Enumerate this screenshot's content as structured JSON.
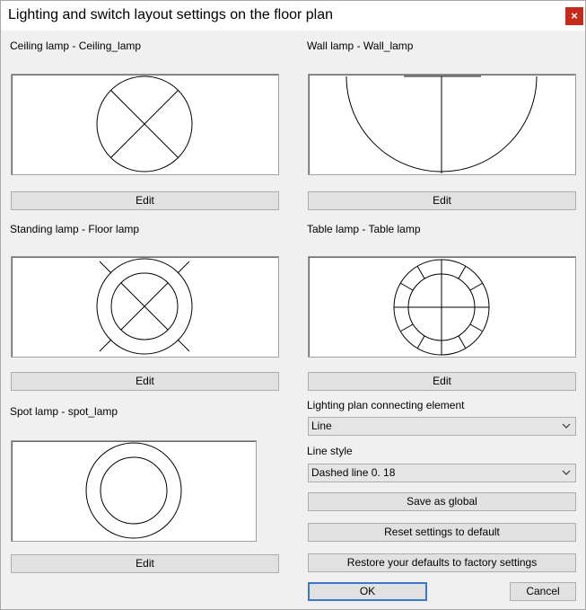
{
  "window": {
    "title": "Lighting and switch layout settings on the floor plan",
    "close_glyph": "×"
  },
  "lamps": {
    "ceiling": {
      "label": "Ceiling lamp - Ceiling_lamp",
      "edit": "Edit"
    },
    "wall": {
      "label": "Wall lamp - Wall_lamp",
      "edit": "Edit"
    },
    "standing": {
      "label": "Standing lamp - Floor lamp",
      "edit": "Edit"
    },
    "table": {
      "label": "Table lamp - Table lamp",
      "edit": "Edit"
    },
    "spot": {
      "label": "Spot lamp - spot_lamp",
      "edit": "Edit"
    }
  },
  "connecting": {
    "label": "Lighting plan connecting element",
    "value": "Line"
  },
  "line_style": {
    "label": "Line style",
    "value": "Dashed line 0. 18"
  },
  "actions": {
    "save_global": "Save as global",
    "reset_default": "Reset settings to default",
    "restore_factory": "Restore your defaults to factory settings",
    "ok": "OK",
    "cancel": "Cancel"
  },
  "icons": {
    "close": "close-icon",
    "dropdown": "chevron-down-icon"
  }
}
